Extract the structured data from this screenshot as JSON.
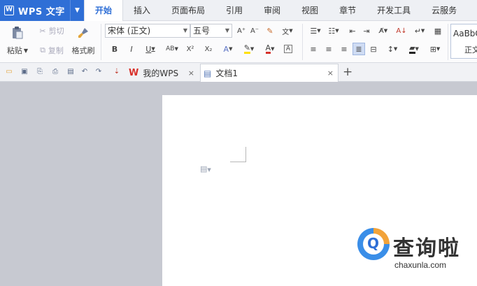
{
  "app": {
    "name": "WPS 文字",
    "logo_letter": "W"
  },
  "menu_tabs": [
    "开始",
    "插入",
    "页面布局",
    "引用",
    "审阅",
    "视图",
    "章节",
    "开发工具",
    "云服务"
  ],
  "active_tab": "开始",
  "ribbon": {
    "paste_label": "粘贴",
    "cut_label": "剪切",
    "copy_label": "复制",
    "format_painter_label": "格式刷",
    "font_name": "宋体 (正文)",
    "font_size": "五号",
    "bold_label": "B",
    "italic_label": "I",
    "underline_label": "U",
    "strike_label": "AB",
    "superscript_label": "X²",
    "subscript_label": "X₂",
    "text_effect_label": "A",
    "font_color_label": "A",
    "increase_font_label": "A⁺",
    "decrease_font_label": "A⁻",
    "style_preview": "AaBbC",
    "style_name": "正文"
  },
  "tabs": {
    "home_tab_label": "我的WPS",
    "doc_tab_label": "文档1",
    "close_glyph": "×",
    "new_tab_glyph": "+"
  },
  "watermark": {
    "brand": "查询啦",
    "url": "chaxunla.com"
  },
  "colors": {
    "accent": "#2f6fd6",
    "workspace": "#c7c9d1",
    "wps_red": "#d9312b"
  }
}
